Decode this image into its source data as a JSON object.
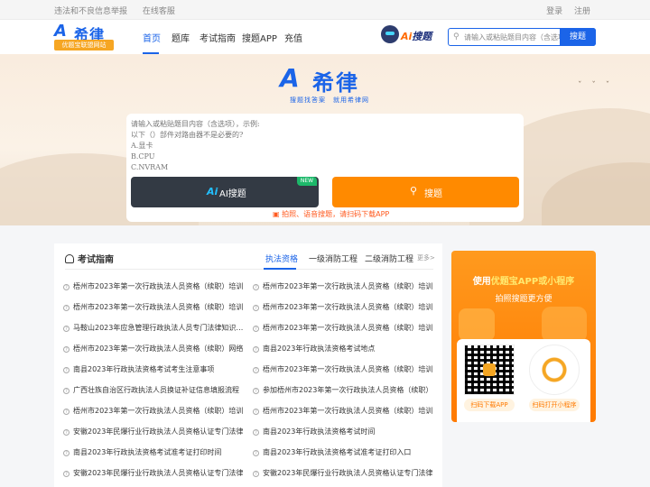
{
  "topbar": {
    "report": "违法和不良信息举报",
    "service": "在线客服",
    "login": "登录",
    "register": "注册"
  },
  "brand": {
    "mark": "A",
    "name": "希律",
    "tag": "优题宝联盟网站",
    "slogan": "搜题找答案　就用希律网"
  },
  "nav": [
    "首页",
    "题库",
    "考试指南",
    "搜题APP",
    "充值"
  ],
  "ai_badge": {
    "ai": "Ai",
    "text": "搜题"
  },
  "header_search": {
    "placeholder": "请输入或粘贴题目内容（含选项）",
    "button": "搜题"
  },
  "main_search": {
    "lines": [
      "请输入或粘贴题目内容（含选项），示例:",
      "以下（）部件对路由器不是必要的?",
      "A.显卡",
      "B.CPU",
      "C.NVRAM"
    ],
    "ai_button": "AI搜题",
    "ai_mark": "Ai",
    "new_badge": "NEW",
    "search_button": "搜题",
    "hint": "拍照、语音搜题，请扫码下载APP"
  },
  "guide": {
    "title": "考试指南",
    "tabs": [
      "执法资格",
      "一级消防工程",
      "二级消防工程"
    ],
    "more": "更多>",
    "left": [
      "梧州市2023年第一次行政执法人员资格（续职）培训",
      "梧州市2023年第一次行政执法人员资格（续职）培训",
      "马鞍山2023年应急管理行政执法人员专门法律知识考试",
      "梧州市2023年第一次行政执法人员资格（续职）网络",
      "南县2023年行政执法资格考试考生注意事项",
      "广西壮族自治区行政执法人员换证补证信息填报流程",
      "梧州市2023年第一次行政执法人员资格（续职）培训",
      "安徽2023年民爆行业行政执法人员资格认证专门法律",
      "南县2023年行政执法资格考试准考证打印时间",
      "安徽2023年民爆行业行政执法人员资格认证专门法律"
    ],
    "right": [
      "梧州市2023年第一次行政执法人员资格（续职）培训",
      "梧州市2023年第一次行政执法人员资格（续职）培训",
      "梧州市2023年第一次行政执法人员资格（续职）培训",
      "南县2023年行政执法资格考试地点",
      "梧州市2023年第一次行政执法人员资格（续职）培训",
      "参加梧州市2023年第一次行政执法人员资格（续职）",
      "梧州市2023年第一次行政执法人员资格（续职）培训",
      "南县2023年行政执法资格考试时间",
      "南县2023年行政执法资格考试准考证打印入口",
      "安徽2023年民爆行业行政执法人员资格认证专门法律"
    ]
  },
  "promo": {
    "line1_pre": "使用",
    "line1_hl": "优题宝APP或小程序",
    "line2": "拍照搜题更方便",
    "qr_app": "扫码下载APP",
    "qr_mini": "扫码打开小程序"
  },
  "colors": {
    "primary": "#1b64e8",
    "orange": "#ff8a00",
    "hint": "#ff5a1f"
  }
}
